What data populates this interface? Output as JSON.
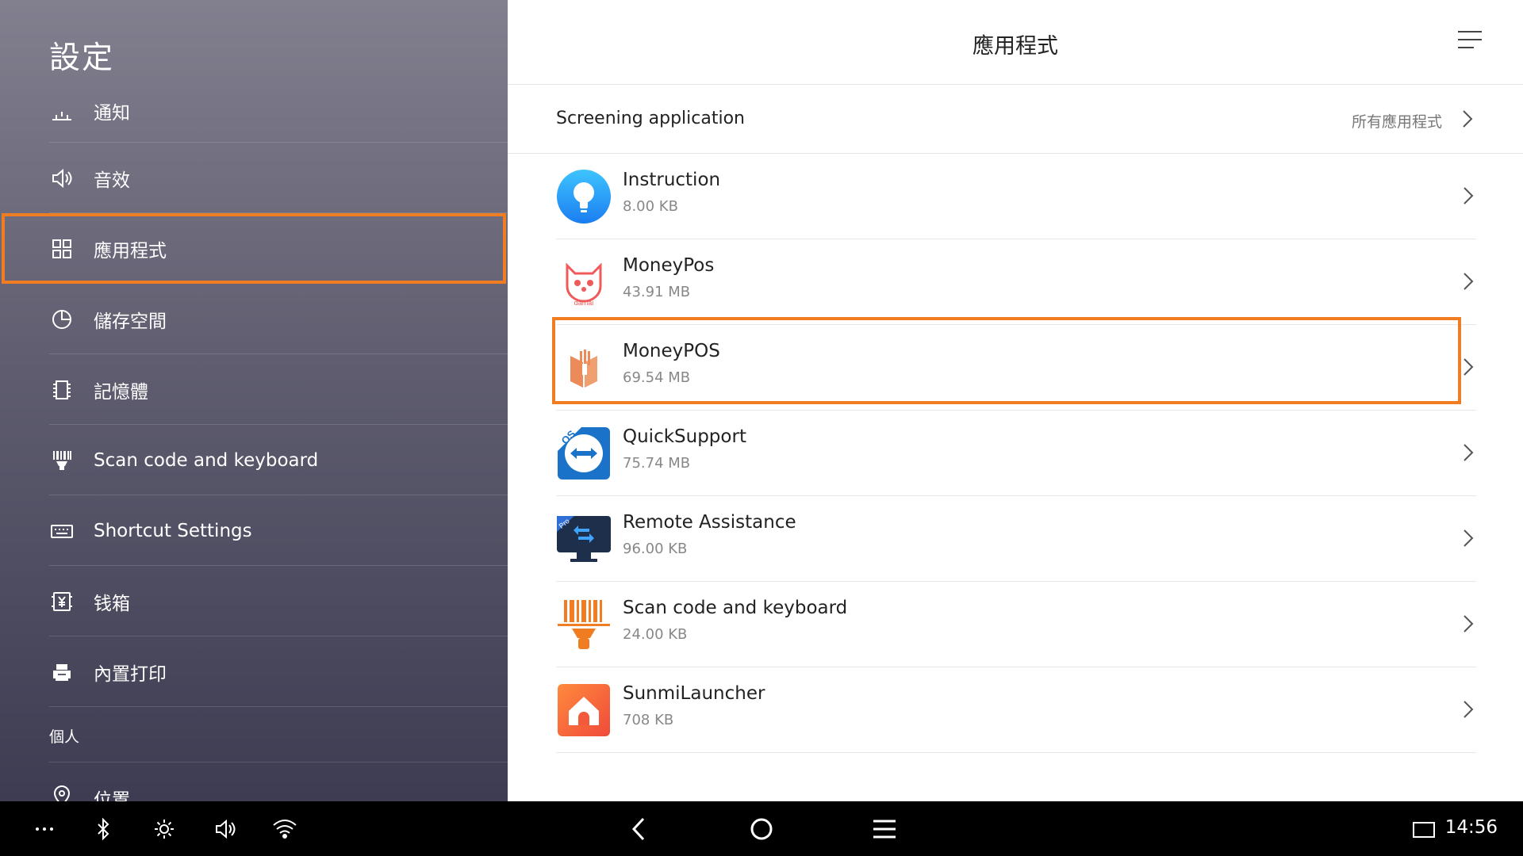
{
  "sidebar": {
    "title": "設定",
    "items": [
      {
        "label": "通知",
        "icon": "notification-icon"
      },
      {
        "label": "音效",
        "icon": "speaker-icon"
      },
      {
        "label": "應用程式",
        "icon": "apps-grid-icon",
        "selected": true
      },
      {
        "label": "儲存空間",
        "icon": "pie-chart-icon"
      },
      {
        "label": "記憶體",
        "icon": "memory-chip-icon"
      },
      {
        "label": "Scan code and keyboard",
        "icon": "barcode-scanner-icon"
      },
      {
        "label": "Shortcut Settings",
        "icon": "keyboard-icon"
      },
      {
        "label": "钱箱",
        "icon": "cash-box-icon"
      },
      {
        "label": "內置打印",
        "icon": "printer-icon"
      }
    ],
    "section_header": "個人",
    "location_item": {
      "label": "位置",
      "icon": "location-icon"
    }
  },
  "header": {
    "title": "應用程式",
    "menu_icon": "menu-lines-icon"
  },
  "screening": {
    "label": "Screening application",
    "value": "所有應用程式"
  },
  "apps": [
    {
      "name": "Instruction",
      "size": "8.00 KB",
      "icon": "instruction-bulb-icon"
    },
    {
      "name": "MoneyPos",
      "size": "43.91 MB",
      "icon": "moneypos-cat-icon"
    },
    {
      "name": "MoneyPOS",
      "size": "69.54 MB",
      "icon": "moneypos-fork-icon",
      "highlighted": true
    },
    {
      "name": "QuickSupport",
      "size": "75.74 MB",
      "icon": "quicksupport-icon"
    },
    {
      "name": "Remote Assistance",
      "size": "96.00 KB",
      "icon": "remote-assistance-icon"
    },
    {
      "name": "Scan code and keyboard",
      "size": "24.00 KB",
      "icon": "scan-code-icon"
    },
    {
      "name": "SunmiLauncher",
      "size": "708 KB",
      "icon": "sunmi-launcher-icon"
    }
  ],
  "navbar": {
    "clock": "14:56",
    "colors": {
      "background": "#000000",
      "highlight": "#f07d22"
    }
  }
}
